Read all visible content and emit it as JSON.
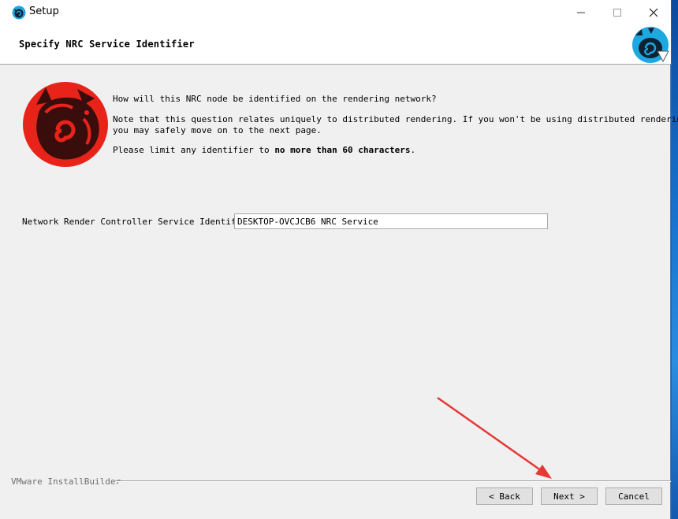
{
  "window": {
    "title": "Setup"
  },
  "header": {
    "page_title": "Specify NRC Service Identifier"
  },
  "content": {
    "question": "How will this NRC node be identified on the rendering network?",
    "note_line1": "Note that this question relates uniquely to distributed rendering. If you won't be using distributed rendering,",
    "note_line2": "you may safely move on to the next page.",
    "limit_prefix": "Please limit any identifier to ",
    "limit_bold": "no more than 60 characters",
    "limit_suffix": "."
  },
  "field": {
    "label": "Network Render Controller Service Identifier",
    "value": "DESKTOP-OVCJCB6 NRC Service"
  },
  "footer": {
    "brand": "VMware InstallBuilder",
    "back_label": "< Back",
    "next_label": "Next >",
    "cancel_label": "Cancel"
  },
  "colors": {
    "logo_red": "#e8231a",
    "logo_dark": "#3a0d0d",
    "header_logo_blue": "#1ea8e0",
    "annotation_arrow": "#e53935"
  },
  "icons": [
    "app-icon",
    "minimize-icon",
    "maximize-icon",
    "close-icon",
    "header-logo-icon",
    "product-logo-icon"
  ]
}
